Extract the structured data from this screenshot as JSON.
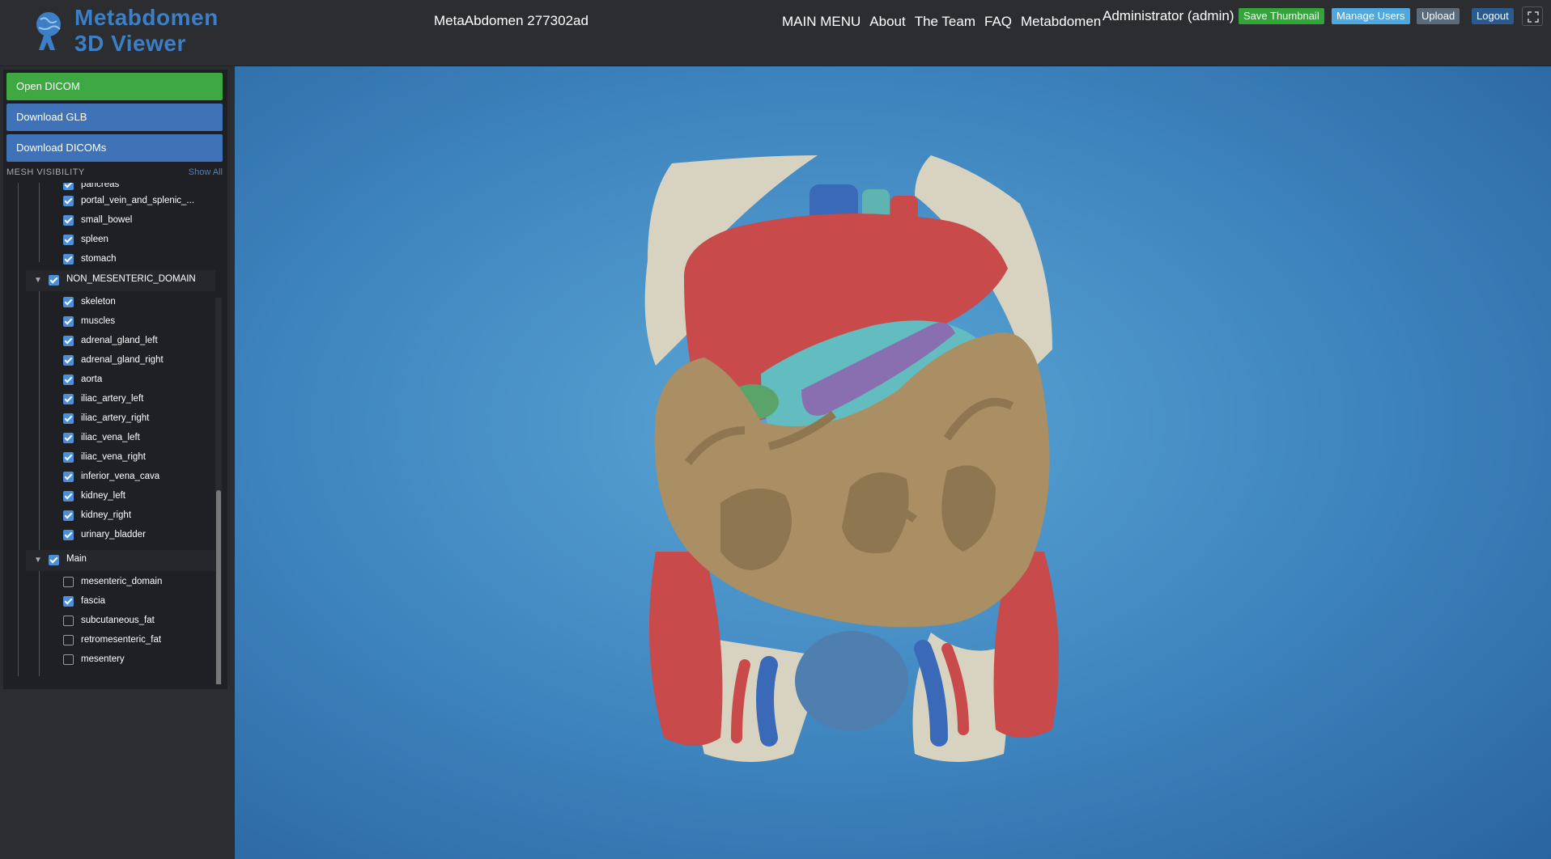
{
  "header": {
    "logo_line1": "Metabdomen",
    "logo_line2": "3D Viewer",
    "case_id": "MetaAbdomen 277302ad",
    "nav": [
      "MAIN MENU",
      "About",
      "The Team",
      "FAQ",
      "Metabdomen"
    ],
    "user": "Administrator (admin)",
    "buttons": {
      "save_thumbnail": "Save Thumbnail",
      "manage_users": "Manage Users",
      "upload": "Upload",
      "logout": "Logout"
    }
  },
  "sidebar": {
    "open_dicom": "Open DICOM",
    "download_glb": "Download GLB",
    "download_dicoms": "Download DICOMs",
    "mesh_visibility": "MESH VISIBILITY",
    "show_all": "Show All",
    "tree": {
      "group1_items": [
        {
          "label": "pancreas",
          "checked": true
        },
        {
          "label": "portal_vein_and_splenic_...",
          "checked": true
        },
        {
          "label": "small_bowel",
          "checked": true
        },
        {
          "label": "spleen",
          "checked": true
        },
        {
          "label": "stomach",
          "checked": true
        }
      ],
      "group2": {
        "label": "NON_MESENTERIC_DOMAIN",
        "checked": true,
        "items": [
          {
            "label": "skeleton",
            "checked": true
          },
          {
            "label": "muscles",
            "checked": true
          },
          {
            "label": "adrenal_gland_left",
            "checked": true
          },
          {
            "label": "adrenal_gland_right",
            "checked": true
          },
          {
            "label": "aorta",
            "checked": true
          },
          {
            "label": "iliac_artery_left",
            "checked": true
          },
          {
            "label": "iliac_artery_right",
            "checked": true
          },
          {
            "label": "iliac_vena_left",
            "checked": true
          },
          {
            "label": "iliac_vena_right",
            "checked": true
          },
          {
            "label": "inferior_vena_cava",
            "checked": true
          },
          {
            "label": "kidney_left",
            "checked": true
          },
          {
            "label": "kidney_right",
            "checked": true
          },
          {
            "label": "urinary_bladder",
            "checked": true
          }
        ]
      },
      "group3": {
        "label": "Main",
        "checked": true,
        "items": [
          {
            "label": "mesenteric_domain",
            "checked": false
          },
          {
            "label": "fascia",
            "checked": true
          },
          {
            "label": "subcutaneous_fat",
            "checked": false
          },
          {
            "label": "retromesenteric_fat",
            "checked": false
          },
          {
            "label": "mesentery",
            "checked": false
          }
        ]
      }
    }
  },
  "colors": {
    "green": "#3ea942",
    "blue": "#3f72b6",
    "organ_red": "#c84a4a",
    "organ_tan": "#a98f63",
    "bone": "#d8d3c0"
  }
}
